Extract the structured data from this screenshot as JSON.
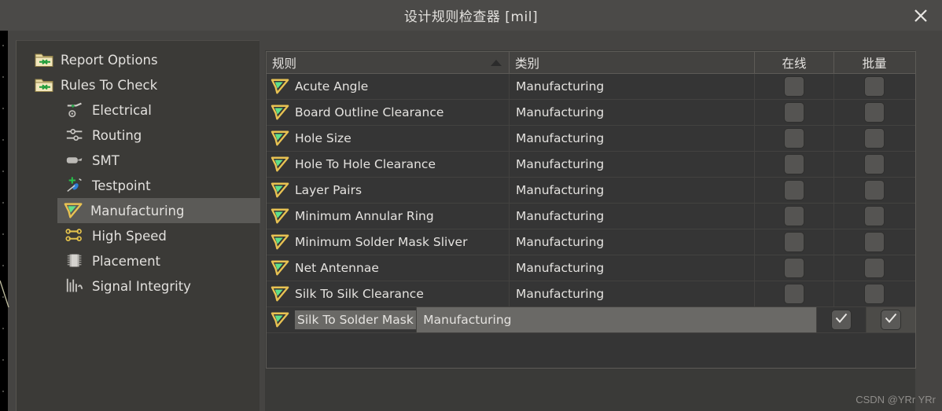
{
  "window": {
    "title": "设计规则检查器 [mil]",
    "close_label": "×",
    "close_icon": "close-icon"
  },
  "sidebar": {
    "items": [
      {
        "label": "Report Options",
        "icon": "folder-arrow-icon",
        "level": "root",
        "selected": false
      },
      {
        "label": "Rules To Check",
        "icon": "folder-arrow-icon",
        "level": "root",
        "selected": false
      },
      {
        "label": "Electrical",
        "icon": "electrical-icon",
        "level": "child",
        "selected": false
      },
      {
        "label": "Routing",
        "icon": "routing-icon",
        "level": "child",
        "selected": false
      },
      {
        "label": "SMT",
        "icon": "smt-icon",
        "level": "child",
        "selected": false
      },
      {
        "label": "Testpoint",
        "icon": "testpoint-icon",
        "level": "child",
        "selected": false
      },
      {
        "label": "Manufacturing",
        "icon": "manufacturing-icon",
        "level": "child",
        "selected": true
      },
      {
        "label": "High Speed",
        "icon": "high-speed-icon",
        "level": "child",
        "selected": false
      },
      {
        "label": "Placement",
        "icon": "placement-icon",
        "level": "child",
        "selected": false
      },
      {
        "label": "Signal Integrity",
        "icon": "signal-integrity-icon",
        "level": "child",
        "selected": false
      }
    ]
  },
  "table": {
    "columns": [
      "规则",
      "类别",
      "在线",
      "批量"
    ],
    "sort_column": "规则",
    "sort_direction": "ascending",
    "sort_icon": "sort-ascending-icon",
    "row_icon": "manufacturing-rule-icon",
    "rows": [
      {
        "rule": "Acute Angle",
        "category": "Manufacturing",
        "online": false,
        "batch": false,
        "selected": false
      },
      {
        "rule": "Board Outline Clearance",
        "category": "Manufacturing",
        "online": false,
        "batch": false,
        "selected": false
      },
      {
        "rule": "Hole Size",
        "category": "Manufacturing",
        "online": false,
        "batch": false,
        "selected": false
      },
      {
        "rule": "Hole To Hole Clearance",
        "category": "Manufacturing",
        "online": false,
        "batch": false,
        "selected": false
      },
      {
        "rule": "Layer Pairs",
        "category": "Manufacturing",
        "online": false,
        "batch": false,
        "selected": false
      },
      {
        "rule": "Minimum Annular Ring",
        "category": "Manufacturing",
        "online": false,
        "batch": false,
        "selected": false
      },
      {
        "rule": "Minimum Solder Mask Sliver",
        "category": "Manufacturing",
        "online": false,
        "batch": false,
        "selected": false
      },
      {
        "rule": "Net Antennae",
        "category": "Manufacturing",
        "online": false,
        "batch": false,
        "selected": false
      },
      {
        "rule": "Silk To Silk Clearance",
        "category": "Manufacturing",
        "online": false,
        "batch": false,
        "selected": false
      },
      {
        "rule": "Silk To Solder Mask Clearance",
        "category": "Manufacturing",
        "online": true,
        "batch": true,
        "selected": true
      }
    ]
  },
  "watermark": {
    "text": "CSDN @YRr YRr"
  },
  "colors": {
    "titlebar": "#4b4a48",
    "window_bg": "#454442",
    "sidebar_bg": "#3b3a37",
    "table_bg": "#353535",
    "header_bg": "#434240",
    "selection": "#6a6966",
    "sidebar_selection": "#5b5a57",
    "text": "#e4e2df",
    "icon_gold": "#e8c252",
    "icon_green": "#5fe08a"
  }
}
